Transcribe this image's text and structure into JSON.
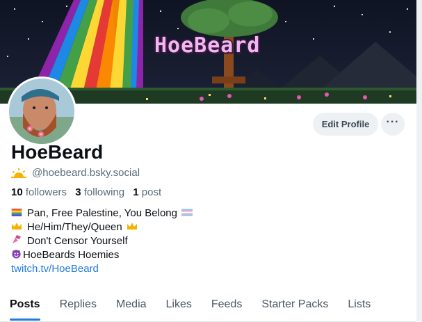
{
  "banner": {
    "title": "HoeBeard"
  },
  "profile": {
    "display_name": "HoeBeard",
    "handle": "@hoebeard.bsky.social",
    "handle_icon": "sun-icon",
    "stats": {
      "followers_count": "10",
      "followers_label": "followers",
      "following_count": "3",
      "following_label": "following",
      "posts_count": "1",
      "posts_label": "post"
    },
    "bio": {
      "line1": "Pan, Free Palestine, You Belong",
      "line2": "He/Him/They/Queen",
      "line3": "Don't Censor Yourself",
      "line4": "HoeBeards Hoemies",
      "link": "twitch.tv/HoeBeard"
    }
  },
  "actions": {
    "edit_profile_label": "Edit Profile",
    "more_label": "···"
  },
  "tabs": [
    {
      "label": "Posts"
    },
    {
      "label": "Replies"
    },
    {
      "label": "Media"
    },
    {
      "label": "Likes"
    },
    {
      "label": "Feeds"
    },
    {
      "label": "Starter Packs"
    },
    {
      "label": "Lists"
    }
  ],
  "colors": {
    "accent": "#1f7ae0",
    "button_bg": "#edf1f4",
    "muted_text": "#5b6b7c"
  }
}
